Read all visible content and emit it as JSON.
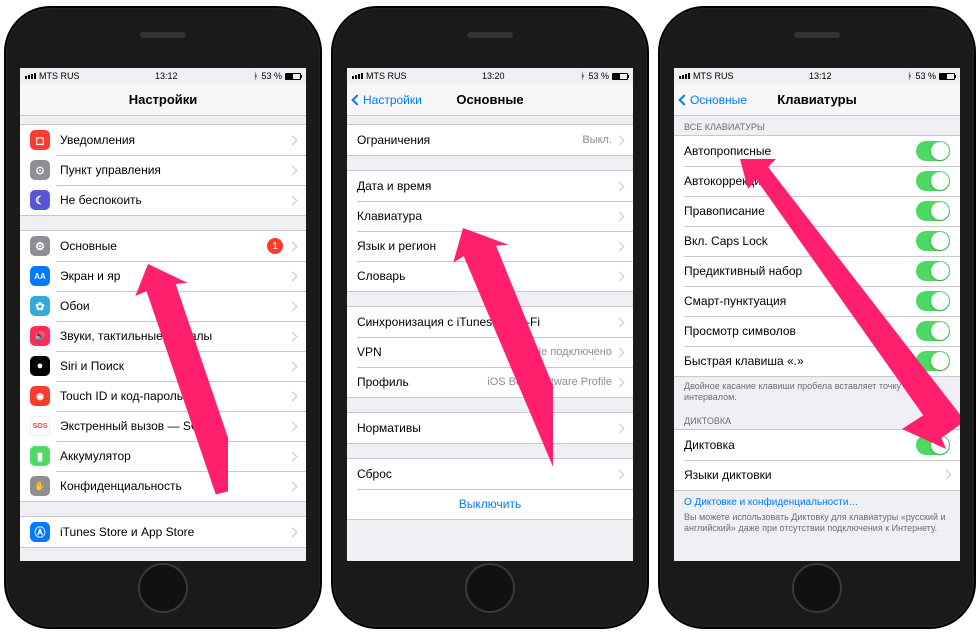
{
  "status": {
    "carrier": "MTS RUS",
    "wifi_glyph": "᯾",
    "battery_pct": "53 %"
  },
  "phones": [
    {
      "time": "13:12",
      "title": "Настройки",
      "back": null,
      "groups": [
        {
          "rows": [
            {
              "icon": {
                "bg": "#ff3b30",
                "glyph": "◻"
              },
              "name": "notifications",
              "label": "Уведомления"
            },
            {
              "icon": {
                "bg": "#8e8e93",
                "glyph": "⊙"
              },
              "name": "control-center",
              "label": "Пункт управления"
            },
            {
              "icon": {
                "bg": "#5856d6",
                "glyph": "☾"
              },
              "name": "dnd",
              "label": "Не беспокоить"
            }
          ]
        },
        {
          "rows": [
            {
              "icon": {
                "bg": "#8e8e93",
                "glyph": "⚙"
              },
              "name": "general",
              "label": "Основные",
              "badge": "1"
            },
            {
              "icon": {
                "bg": "#007aff",
                "glyph": "AA"
              },
              "name": "display",
              "label": "Экран и яр"
            },
            {
              "icon": {
                "bg": "#34aadc",
                "glyph": "✿"
              },
              "name": "wallpaper",
              "label": "Обои"
            },
            {
              "icon": {
                "bg": "#ff2d55",
                "glyph": "🔊"
              },
              "name": "sounds",
              "label": "Звуки, тактильные сигналы"
            },
            {
              "icon": {
                "bg": "#000",
                "glyph": "●"
              },
              "name": "siri",
              "label": "Siri и Поиск"
            },
            {
              "icon": {
                "bg": "#ff3b30",
                "glyph": "👆"
              },
              "name": "touchid",
              "label": "Touch ID и код-пароль"
            },
            {
              "icon": {
                "bg": "#ff3b30",
                "glyph": "SOS"
              },
              "name": "sos",
              "label": "Экстренный вызов — SOS"
            },
            {
              "icon": {
                "bg": "#4cd964",
                "glyph": "▮"
              },
              "name": "battery",
              "label": "Аккумулятор"
            },
            {
              "icon": {
                "bg": "#8e8e93",
                "glyph": "✋"
              },
              "name": "privacy",
              "label": "Конфиденциальность"
            }
          ]
        },
        {
          "rows": [
            {
              "icon": {
                "bg": "#007aff",
                "glyph": "Ⓐ"
              },
              "name": "itunes",
              "label": "iTunes Store и App Store"
            }
          ]
        }
      ]
    },
    {
      "time": "13:20",
      "title": "Основные",
      "back": "Настройки",
      "groups": [
        {
          "rows": [
            {
              "name": "restrictions",
              "label": "Ограничения",
              "detail": "Выкл."
            }
          ]
        },
        {
          "rows": [
            {
              "name": "date-time",
              "label": "Дата и время"
            },
            {
              "name": "keyboard",
              "label": "Клавиатура"
            },
            {
              "name": "language-region",
              "label": "Язык и регион"
            },
            {
              "name": "dictionary",
              "label": "Словарь"
            }
          ]
        },
        {
          "rows": [
            {
              "name": "itunes-wifi-sync",
              "label": "Синхронизация с iTunes по Wi-Fi"
            },
            {
              "name": "vpn",
              "label": "VPN",
              "detail": "Не подключено"
            },
            {
              "name": "profile",
              "label": "Профиль",
              "detail": "iOS Beta Software Profile"
            }
          ]
        },
        {
          "rows": [
            {
              "name": "regulatory",
              "label": "Нормативы"
            }
          ]
        },
        {
          "rows": [
            {
              "name": "reset",
              "label": "Сброс"
            },
            {
              "name": "shut-down",
              "label": "Выключить",
              "center": true
            }
          ]
        }
      ]
    },
    {
      "time": "13:12",
      "title": "Клавиатуры",
      "back": "Основные",
      "sections": [
        {
          "header": "ВСЕ КЛАВИАТУРЫ",
          "rows": [
            {
              "name": "auto-caps",
              "label": "Автопрописные",
              "toggle": true
            },
            {
              "name": "auto-correct",
              "label": "Автокоррекция",
              "toggle": true
            },
            {
              "name": "spell-check",
              "label": "Правописание",
              "toggle": true
            },
            {
              "name": "caps-lock",
              "label": "Вкл. Caps Lock",
              "toggle": true
            },
            {
              "name": "predictive",
              "label": "Предиктивный набор",
              "toggle": true
            },
            {
              "name": "smart-punct",
              "label": "Смарт-пунктуация",
              "toggle": true
            },
            {
              "name": "char-preview",
              "label": "Просмотр символов",
              "toggle": true
            },
            {
              "name": "period-shortcut",
              "label": "Быстрая клавиша «.»",
              "toggle": true
            }
          ],
          "footer": "Двойное касание клавиши пробела вставляет точку с интервалом."
        },
        {
          "header": "ДИКТОВКА",
          "rows": [
            {
              "name": "dictation",
              "label": "Диктовка",
              "toggle": true
            },
            {
              "name": "dictation-langs",
              "label": "Языки диктовки",
              "chev": true
            }
          ],
          "link": "О Диктовке и конфиденциальности…",
          "footer": "Вы можете использовать Диктовку для клавиатуры «русский и английский» даже при отсутствии подключения к Интернету."
        }
      ]
    }
  ]
}
